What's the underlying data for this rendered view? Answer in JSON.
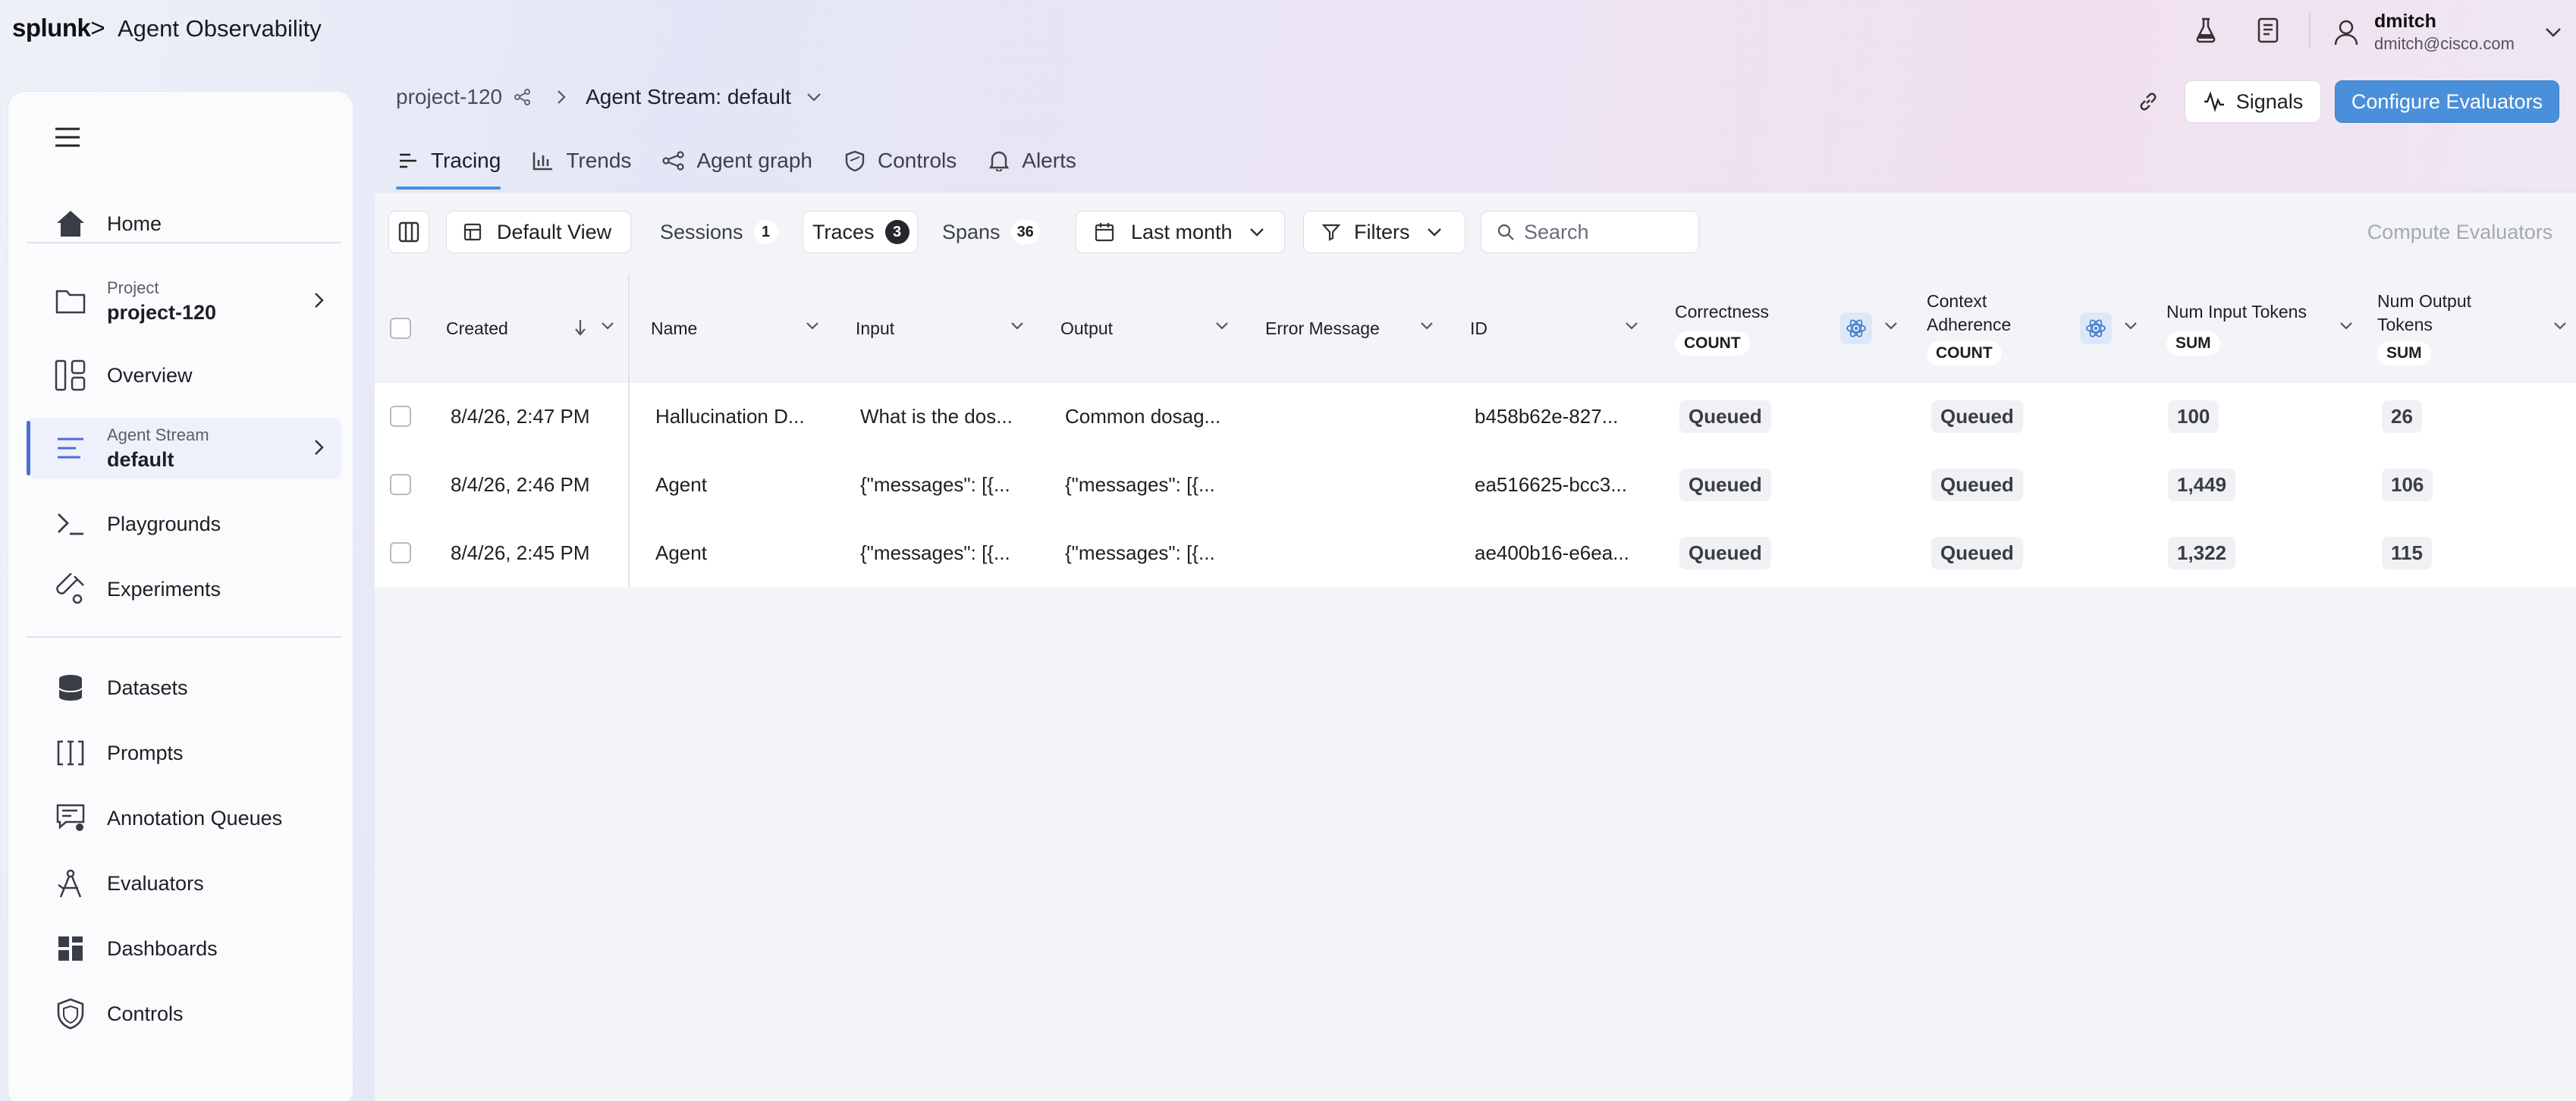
{
  "brand": {
    "logo_text": "splunk",
    "logo_mark": ">",
    "app_title": "Agent Observability"
  },
  "user": {
    "name": "dmitch",
    "email": "dmitch@cisco.com"
  },
  "sidebar": {
    "items": [
      {
        "label": "Home",
        "icon": "home-icon"
      },
      {
        "small": "Project",
        "big": "project-120",
        "icon": "folder-icon"
      },
      {
        "label": "Overview",
        "icon": "overview-icon"
      },
      {
        "small": "Agent Stream",
        "big": "default",
        "icon": "stream-icon"
      },
      {
        "label": "Playgrounds",
        "icon": "terminal-icon"
      },
      {
        "label": "Experiments",
        "icon": "flask-icon"
      },
      {
        "label": "Datasets",
        "icon": "database-icon"
      },
      {
        "label": "Prompts",
        "icon": "prompt-icon"
      },
      {
        "label": "Annotation Queues",
        "icon": "annotation-icon"
      },
      {
        "label": "Evaluators",
        "icon": "evaluator-icon"
      },
      {
        "label": "Dashboards",
        "icon": "dashboard-icon"
      },
      {
        "label": "Controls",
        "icon": "shield-icon"
      }
    ]
  },
  "breadcrumb": {
    "project": "project-120",
    "stream": "Agent Stream: default"
  },
  "header": {
    "signals": "Signals",
    "configure": "Configure Evaluators"
  },
  "tabs": [
    {
      "label": "Tracing",
      "active": true
    },
    {
      "label": "Trends"
    },
    {
      "label": "Agent graph"
    },
    {
      "label": "Controls"
    },
    {
      "label": "Alerts"
    }
  ],
  "toolbar": {
    "view": "Default View",
    "sessions": {
      "label": "Sessions",
      "count": "1"
    },
    "traces": {
      "label": "Traces",
      "count": "3"
    },
    "spans": {
      "label": "Spans",
      "count": "36"
    },
    "date": "Last month",
    "filters": "Filters",
    "search_placeholder": "Search",
    "compute": "Compute Evaluators"
  },
  "table": {
    "columns": {
      "created": "Created",
      "name": "Name",
      "input": "Input",
      "output": "Output",
      "error": "Error Message",
      "id": "ID",
      "correctness": {
        "label": "Correctness",
        "agg": "COUNT"
      },
      "context": {
        "label1": "Context",
        "label2": "Adherence",
        "agg": "COUNT"
      },
      "num_input": {
        "label": "Num Input Tokens",
        "agg": "SUM"
      },
      "num_output": {
        "label1": "Num Output",
        "label2": "Tokens",
        "agg": "SUM"
      }
    },
    "rows": [
      {
        "created": "8/4/26, 2:47 PM",
        "name": "Hallucination D...",
        "input": "What is the dos...",
        "output": "Common dosag...",
        "error": "",
        "id": "b458b62e-827...",
        "correctness": "Queued",
        "context": "Queued",
        "num_input": "100",
        "num_output": "26"
      },
      {
        "created": "8/4/26, 2:46 PM",
        "name": "Agent",
        "input": "{\"messages\": [{...",
        "output": "{\"messages\": [{...",
        "error": "",
        "id": "ea516625-bcc3...",
        "correctness": "Queued",
        "context": "Queued",
        "num_input": "1,449",
        "num_output": "106"
      },
      {
        "created": "8/4/26, 2:45 PM",
        "name": "Agent",
        "input": "{\"messages\": [{...",
        "output": "{\"messages\": [{...",
        "error": "",
        "id": "ae400b16-e6ea...",
        "correctness": "Queued",
        "context": "Queued",
        "num_input": "1,322",
        "num_output": "115"
      }
    ]
  },
  "colors": {
    "accent": "#4a8fd9",
    "active_bar": "#4b6dd8"
  }
}
